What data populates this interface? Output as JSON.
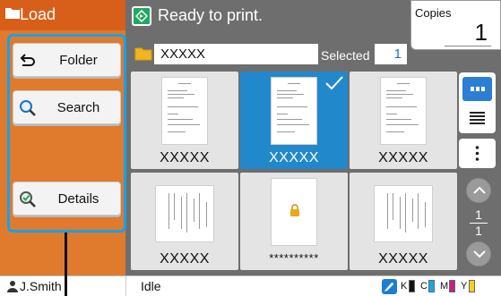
{
  "header": {
    "title": "Load",
    "status": "Ready to print."
  },
  "copies": {
    "label": "Copies",
    "value": "1"
  },
  "sidebar": {
    "buttons": [
      {
        "label": "Folder",
        "icon": "back-arrow-icon"
      },
      {
        "label": "Search",
        "icon": "magnifier-icon"
      },
      {
        "label": "Details",
        "icon": "magnifier-check-icon"
      }
    ]
  },
  "folder": {
    "name": "XXXXX",
    "selected_label": "Selected",
    "selected_count": "1"
  },
  "documents": [
    {
      "label": "XXXXX",
      "selected": false,
      "locked": false
    },
    {
      "label": "XXXXX",
      "selected": true,
      "locked": false
    },
    {
      "label": "XXXXX",
      "selected": false,
      "locked": false
    },
    {
      "label": "XXXXX",
      "selected": false,
      "locked": false
    },
    {
      "label": "**********",
      "selected": false,
      "locked": true
    },
    {
      "label": "XXXXX",
      "selected": false,
      "locked": false
    }
  ],
  "pager": {
    "current": "1",
    "total": "1"
  },
  "footer": {
    "user": "J.Smith",
    "printer_status": "Idle",
    "inks": [
      {
        "label": "K",
        "color": "#111111"
      },
      {
        "label": "C",
        "color": "#1aa7e8"
      },
      {
        "label": "M",
        "color": "#c21e8c"
      },
      {
        "label": "Y",
        "color": "#f2d21a"
      }
    ]
  },
  "colors": {
    "accent_orange": "#e07a2d",
    "selection_blue": "#2288cc",
    "ready_green": "#1fa85f",
    "highlight_blue": "#1aa0e8"
  }
}
